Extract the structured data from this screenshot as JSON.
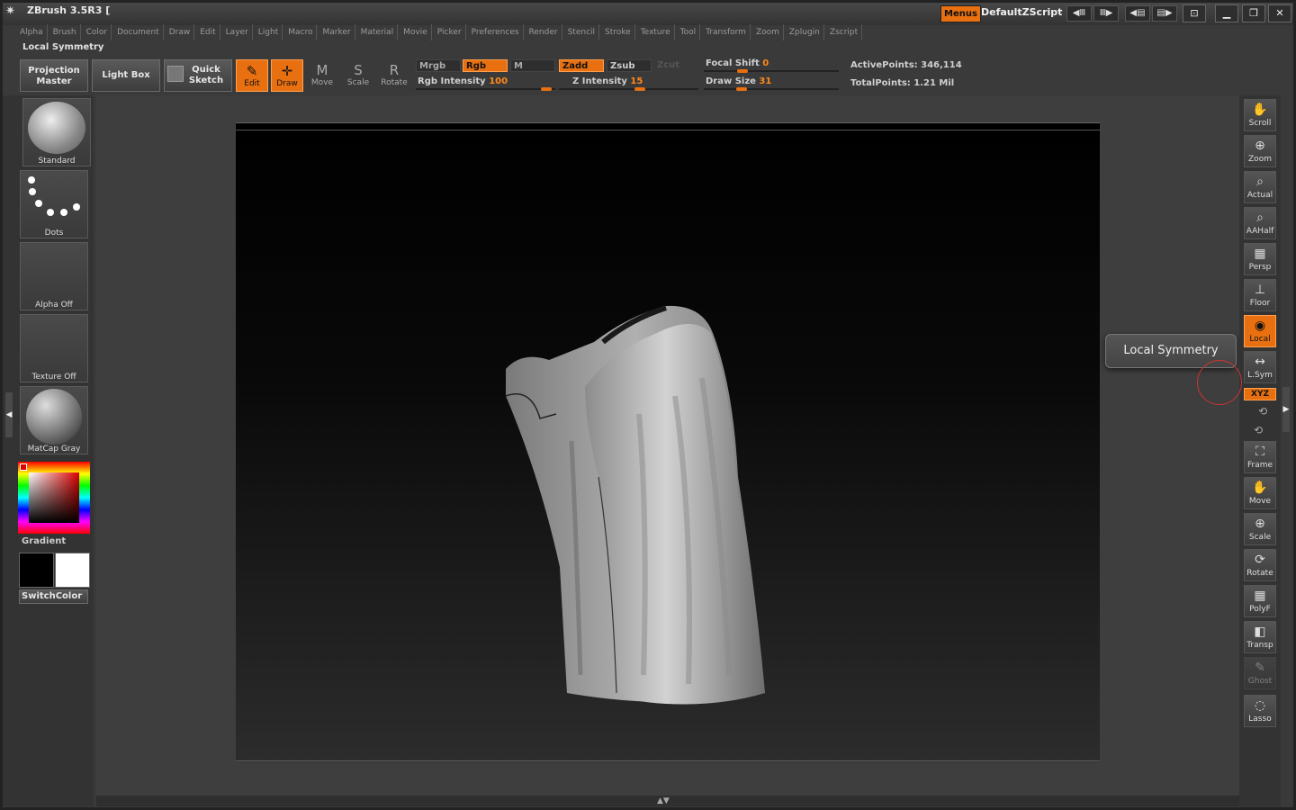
{
  "window": {
    "title": "ZBrush 3.5R3 [",
    "menus_label": "Menus",
    "zscript_name": "DefaultZScript"
  },
  "menu_bar": [
    "Alpha",
    "Brush",
    "Color",
    "Document",
    "Draw",
    "Edit",
    "Layer",
    "Light",
    "Macro",
    "Marker",
    "Material",
    "Movie",
    "Picker",
    "Preferences",
    "Render",
    "Stencil",
    "Stroke",
    "Texture",
    "Tool",
    "Transform",
    "Zoom",
    "Zplugin",
    "Zscript"
  ],
  "palette_title": "Local Symmetry",
  "shelf": {
    "projection_master": [
      "Projection",
      "Master"
    ],
    "light_box": "Light Box",
    "quick_sketch": [
      "Quick",
      "Sketch"
    ],
    "tools": [
      {
        "label": "Edit",
        "glyph": "✎",
        "active": true
      },
      {
        "label": "Draw",
        "glyph": "✛",
        "active": true
      },
      {
        "label": "Move",
        "glyph": "M",
        "active": false
      },
      {
        "label": "Scale",
        "glyph": "S",
        "active": false
      },
      {
        "label": "Rotate",
        "glyph": "R",
        "active": false
      }
    ],
    "mrgb": "Mrgb",
    "rgb": "Rgb",
    "m": "M",
    "zadd": "Zadd",
    "zsub": "Zsub",
    "zcut": "Zcut",
    "rgb_intensity": {
      "label": "Rgb  Intensity",
      "value": "100",
      "fraction": 1.0
    },
    "z_intensity": {
      "label": "Z  Intensity",
      "value": "15",
      "fraction": 0.15
    },
    "focal_shift": {
      "label": "Focal  Shift",
      "value": "0",
      "fraction": 0.5
    },
    "draw_size": {
      "label": "Draw  Size",
      "value": "31",
      "fraction": 0.05
    },
    "active_points": "ActivePoints: 346,114",
    "total_points": "TotalPoints: 1.21  Mil"
  },
  "left_tray": {
    "brush": "Standard",
    "stroke": "Dots",
    "alpha": "Alpha  Off",
    "texture": "Texture  Off",
    "material": "MatCap  Gray",
    "gradient": "Gradient",
    "switch_color": "SwitchColor"
  },
  "right_tray": [
    {
      "label": "Scroll",
      "icon": "hand-icon",
      "glyph": "✋"
    },
    {
      "label": "Zoom",
      "icon": "zoom-icon",
      "glyph": "⊕"
    },
    {
      "label": "Actual",
      "icon": "actual-icon",
      "glyph": "⌕"
    },
    {
      "label": "AAHalf",
      "icon": "aahalf-icon",
      "glyph": "⌕"
    },
    {
      "label": "Persp",
      "icon": "persp-icon",
      "glyph": "▦"
    },
    {
      "label": "Floor",
      "icon": "floor-icon",
      "glyph": "⊥"
    },
    {
      "label": "Local",
      "icon": "local-icon",
      "glyph": "◉",
      "active": true
    },
    {
      "label": "L.Sym",
      "icon": "lsym-icon",
      "glyph": "↔"
    },
    {
      "label": "Frame",
      "icon": "frame-icon",
      "glyph": "⛶"
    },
    {
      "label": "Move",
      "icon": "move-icon",
      "glyph": "✋"
    },
    {
      "label": "Scale",
      "icon": "scale-icon",
      "glyph": "⊕"
    },
    {
      "label": "Rotate",
      "icon": "rotate-icon",
      "glyph": "⟳"
    },
    {
      "label": "PolyF",
      "icon": "polyframe-icon",
      "glyph": "▦"
    },
    {
      "label": "Transp",
      "icon": "transp-icon",
      "glyph": "◧"
    },
    {
      "label": "Ghost",
      "icon": "ghost-icon",
      "glyph": "✎",
      "dim": true
    },
    {
      "label": "Lasso",
      "icon": "lasso-icon",
      "glyph": "◌"
    }
  ],
  "xyz_label": "XYZ",
  "tooltip": "Local Symmetry"
}
